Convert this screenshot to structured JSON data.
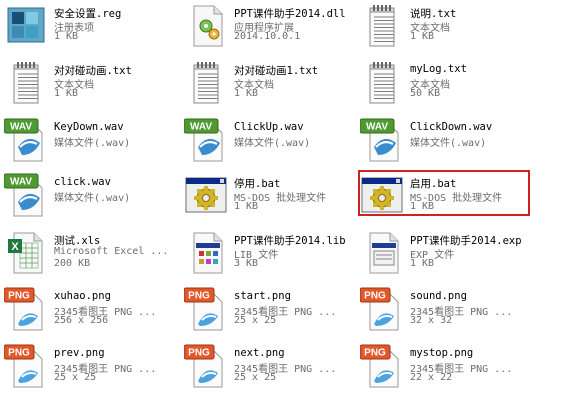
{
  "files": [
    {
      "name": "安全设置.reg",
      "type": "注册表项",
      "meta": "1 KB",
      "icon": "reg-icon"
    },
    {
      "name": "PPT课件助手2014.dll",
      "type": "应用程序扩展",
      "meta": "2014.10.0.1",
      "icon": "dll-icon"
    },
    {
      "name": "说明.txt",
      "type": "文本文档",
      "meta": "1 KB",
      "icon": "txt-icon"
    },
    {
      "name": "对对碰动画.txt",
      "type": "文本文档",
      "meta": "1 KB",
      "icon": "txt-icon"
    },
    {
      "name": "对对碰动画1.txt",
      "type": "文本文档",
      "meta": "1 KB",
      "icon": "txt-icon"
    },
    {
      "name": "myLog.txt",
      "type": "文本文档",
      "meta": "50 KB",
      "icon": "txt-icon"
    },
    {
      "name": "KeyDown.wav",
      "type": "媒体文件(.wav)",
      "meta": "",
      "icon": "wav-icon"
    },
    {
      "name": "ClickUp.wav",
      "type": "媒体文件(.wav)",
      "meta": "",
      "icon": "wav-icon"
    },
    {
      "name": "ClickDown.wav",
      "type": "媒体文件(.wav)",
      "meta": "",
      "icon": "wav-icon"
    },
    {
      "name": "click.wav",
      "type": "媒体文件(.wav)",
      "meta": "",
      "icon": "wav-icon"
    },
    {
      "name": "停用.bat",
      "type": "MS-DOS 批处理文件",
      "meta": "1 KB",
      "icon": "bat-icon"
    },
    {
      "name": "启用.bat",
      "type": "MS-DOS 批处理文件",
      "meta": "1 KB",
      "icon": "bat-icon",
      "highlight": true
    },
    {
      "name": "测试.xls",
      "type": "Microsoft Excel ...",
      "meta": "200 KB",
      "icon": "xls-icon"
    },
    {
      "name": "PPT课件助手2014.lib",
      "type": "LIB 文件",
      "meta": "3 KB",
      "icon": "lib-icon"
    },
    {
      "name": "PPT课件助手2014.exp",
      "type": "EXP 文件",
      "meta": "1 KB",
      "icon": "exp-icon"
    },
    {
      "name": "xuhao.png",
      "type": "2345看图王 PNG ...",
      "meta": "256 x 256",
      "icon": "png-icon"
    },
    {
      "name": "start.png",
      "type": "2345看图王 PNG ...",
      "meta": "25 x 25",
      "icon": "png-icon"
    },
    {
      "name": "sound.png",
      "type": "2345看图王 PNG ...",
      "meta": "32 x 32",
      "icon": "png-icon"
    },
    {
      "name": "prev.png",
      "type": "2345看图王 PNG ...",
      "meta": "25 x 25",
      "icon": "png-icon"
    },
    {
      "name": "next.png",
      "type": "2345看图王 PNG ...",
      "meta": "25 x 25",
      "icon": "png-icon"
    },
    {
      "name": "mystop.png",
      "type": "2345看图王 PNG ...",
      "meta": "22 x 22",
      "icon": "png-icon"
    }
  ],
  "colors": {
    "highlight": "#d21f26",
    "wav_label": "#4f9a32",
    "png_label": "#e2582a"
  }
}
